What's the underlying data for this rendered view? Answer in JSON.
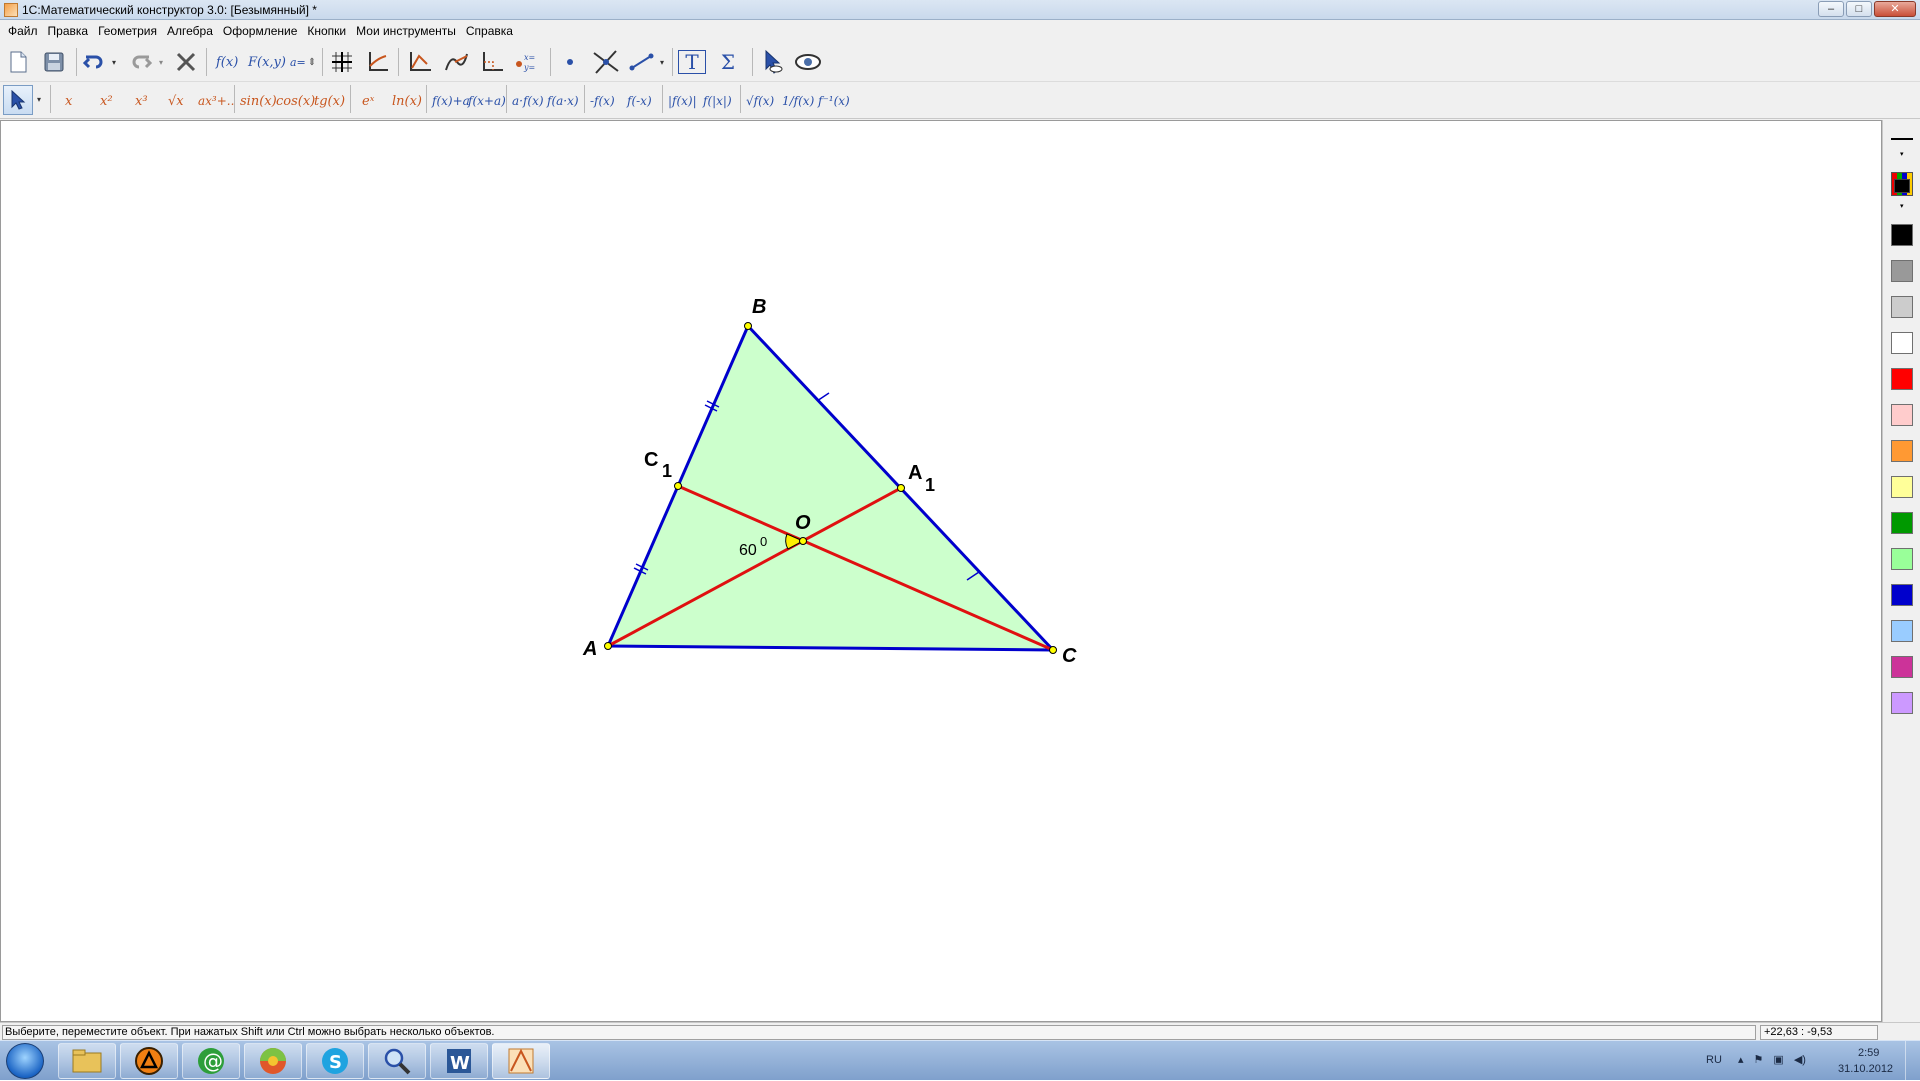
{
  "window": {
    "title": "1С:Математический конструктор 3.0: [Безымянный] *",
    "min_label": "–",
    "max_label": "□",
    "close_label": "✕"
  },
  "menu": [
    "Файл",
    "Правка",
    "Геометрия",
    "Алгебра",
    "Оформление",
    "Кнопки",
    "Мои инструменты",
    "Справка"
  ],
  "toolbar": {
    "fx": "f(x)",
    "fxy": "F(x,y)",
    "param": "a=",
    "text_tool": "T",
    "sum_tool": "Σ",
    "icons": [
      "new-file-icon",
      "save-icon",
      "undo-icon",
      "redo-icon",
      "delete-icon",
      "grid-icon",
      "axes-icon",
      "graph-icon",
      "curve-icon",
      "coordinate-icon",
      "point-table-icon",
      "point-icon",
      "intersection-icon",
      "segment-icon",
      "text-icon",
      "sum-icon",
      "cursor-eye-icon",
      "eye-icon"
    ]
  },
  "functions": {
    "x": "x",
    "x2": "x²",
    "x3": "x³",
    "sqrt": "√x",
    "poly": "ax³+..",
    "sin": "sin(x)",
    "cos": "cos(x)",
    "tg": "tg(x)",
    "exp": "eˣ",
    "ln": "ln(x)",
    "shift_y": "f(x)+a",
    "shift_x": "f(x+a)",
    "scale_y": "a·f(x)",
    "scale_x": "f(a·x)",
    "neg_f": "-f(x)",
    "f_neg_x": "f(-x)",
    "abs_f": "|f(x)|",
    "f_abs_x": "f(|x|)",
    "sqrt_f": "√f(x)",
    "recip": "1/f(x)",
    "inverse": "f⁻¹(x)"
  },
  "drawing": {
    "points": [
      {
        "label": "A"
      },
      {
        "label": "B"
      },
      {
        "label": "C"
      },
      {
        "label": "C",
        "sub": "1"
      },
      {
        "label": "A",
        "sub": "1"
      },
      {
        "label": "O"
      }
    ],
    "angle": {
      "value": "60",
      "sup": "0"
    },
    "colors": {
      "fill": "#ccffcc",
      "sides": "#0000cc",
      "medians": "#e01010",
      "angle": "#ffee00",
      "point": "#ffff00"
    }
  },
  "palette": {
    "current_color": "#000000",
    "colors": [
      "#000000",
      "#999999",
      "#cccccc",
      "#ffffff",
      "#ff0000",
      "#ffcccc",
      "#ff9933",
      "#ffff99",
      "#009900",
      "#99ff99",
      "#0000cc",
      "#99ccff",
      "#cc3399",
      "#cc99ff"
    ]
  },
  "status": {
    "message": "Выберите, переместите объект. При нажатых Shift или Ctrl можно выбрать несколько объектов.",
    "coords": "+22,63 : -9,53"
  },
  "taskbar": {
    "apps": [
      "explorer-icon",
      "avast-icon",
      "mail-icon",
      "chrome-like-icon",
      "skype-icon",
      "search-tool-icon",
      "word-icon",
      "math-constructor-icon"
    ],
    "lang": "RU",
    "time": "2:59",
    "date": "31.10.2012"
  }
}
